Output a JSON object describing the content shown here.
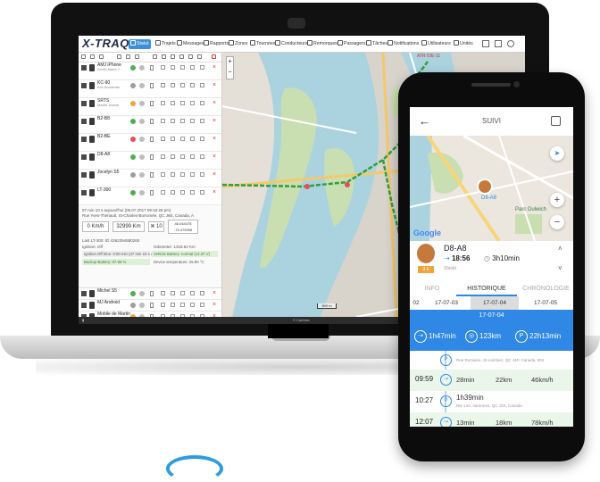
{
  "web_app": {
    "logo": "X-TRAQ",
    "nav_tabs": [
      "Statut",
      "Trajets",
      "Messages",
      "Rapports",
      "Zones",
      "Tournées",
      "Conducteurs",
      "Remorques",
      "Passagers",
      "Tâches",
      "Notifications",
      "Utilisateurs",
      "Unités"
    ],
    "active_tab": "Statut",
    "vehicles": [
      {
        "name": "AMJ iPhone",
        "sub": "Annie-Marie J."
      },
      {
        "name": "KC-90",
        "sub": "Eric Boudreau"
      },
      {
        "name": "SRTS",
        "sub": "Martin Jodoin"
      },
      {
        "name": "B2-B8",
        "sub": ""
      },
      {
        "name": "B2-BE",
        "sub": ""
      },
      {
        "name": "D8-A8",
        "sub": ""
      },
      {
        "name": "Jocelyn S5",
        "sub": ""
      },
      {
        "name": "LT-300",
        "sub": ""
      }
    ],
    "vehicles_after": [
      {
        "name": "Michel S5",
        "sub": ""
      },
      {
        "name": "MJ Android",
        "sub": ""
      },
      {
        "name": "Mobile de Martin",
        "sub": ""
      },
      {
        "name": "Mobile de Serge",
        "sub": ""
      },
      {
        "name": "via tag test",
        "sub": ""
      }
    ],
    "detail": {
      "line1": "97 min 10 s aujourd'hui (05.07.2017 09:16:28 pm)",
      "line2": "Rue Yves-Thériault, St-Charles-Borromée, QC J6E, Canada, A",
      "speed": "0 Km/h",
      "odometer": "32999 Km",
      "sats": "10",
      "coords": "46.044475 -73.479995",
      "last": "Last LT-300: ID 4362394880260",
      "ignition": "Ignition: Off",
      "odometer_label": "Odometer: 1318.62 Km",
      "ignition_off": "Ignition Off time: 0:00 min (47 min 10 s aujourd'hui)",
      "vehicle_battery": "Vehicle Battery: normal (12.37 V)",
      "backup_battery": "Backup Battery: 07.96 %",
      "device_temp": "Device temperature: 25.90 °C"
    },
    "map_labels": [
      "ATR IDE-11"
    ],
    "scale": "500 m",
    "footer": "© Cartotec"
  },
  "mobile_app": {
    "title": "SUIVI",
    "map_labels": [
      "Parc Dulwich",
      "D8-A8"
    ],
    "google": "Google",
    "vehicle_name": "D8-A8",
    "time": "18:56",
    "duration": "3h10min",
    "status": "Shield",
    "badge": "3 h",
    "tabs": [
      "INFO",
      "HISTORIQUE",
      "CHRONOLOGIE"
    ],
    "active_tab": "HISTORIQUE",
    "dates": [
      "02",
      "17-07-03",
      "17-07-04",
      "17-07-05"
    ],
    "selected_date": "17-07-04",
    "summary": {
      "drive_time": "1h47min",
      "distance": "123km",
      "stop_time": "22h13min"
    },
    "first_address": "Rue Romaine, St-Lambert, QC J4P, Canada, 002",
    "trips": [
      {
        "time": "09:59",
        "duration": "28min",
        "distance": "22km",
        "speed": "46km/h"
      },
      {
        "time": "10:27",
        "duration": "1h39min",
        "address": "Rte 132, Varennes, QC J3X, Canada"
      },
      {
        "time": "12:07",
        "duration": "13min",
        "distance": "18km",
        "speed": "78km/h"
      }
    ]
  }
}
